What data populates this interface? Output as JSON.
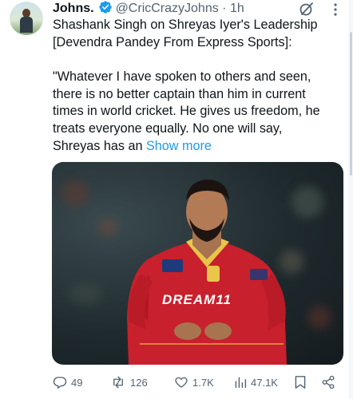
{
  "author": {
    "display_name": "Johns.",
    "handle": "@CricCrazyJohns",
    "separator": "·",
    "timestamp": "1h"
  },
  "tweet": {
    "headline": "Shashank Singh on Shreyas Iyer's Leadership [Devendra Pandey From Express Sports]:",
    "body": "\"Whatever I have spoken to others and seen, there is no better captain than him in current times in world cricket. He gives us freedom, he treats everyone equally. No one will say, Shreyas has an",
    "show_more": "Show more"
  },
  "media": {
    "jersey_sponsor": "DREAM11",
    "icon": "cricketer-photo"
  },
  "actions": {
    "replies": "49",
    "reposts": "126",
    "likes": "1.7K",
    "views": "47.1K"
  },
  "colors": {
    "accent": "#1d9bf0",
    "muted": "#536471",
    "jersey": "#c8202c"
  }
}
